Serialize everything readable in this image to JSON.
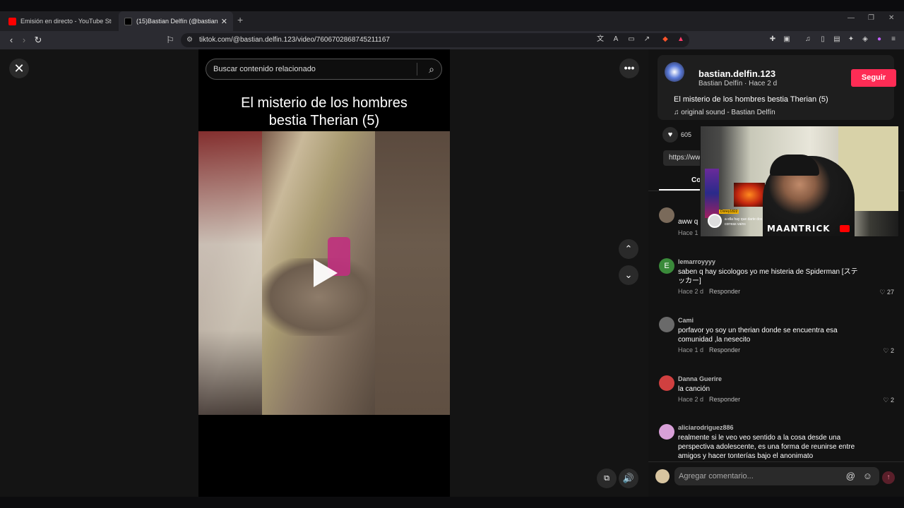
{
  "browser": {
    "tabs": [
      {
        "title": "Emisión en directo - YouTube Studio",
        "favicon_color": "#ff0000"
      },
      {
        "title": "(15)Bastian Delfín (@bastian.delfin",
        "favicon_color": "#000000"
      }
    ],
    "url": "tiktok.com/@bastian.delfin.123/video/7606702868745211167"
  },
  "video": {
    "search_placeholder": "Buscar contenido relacionado",
    "title_line1": "El misterio de los hombres",
    "title_line2": "bestia Therian (5)"
  },
  "author": {
    "username": "bastian.delfin.123",
    "display": "Bastian Delfín · Hace 2 d",
    "follow_label": "Seguir",
    "description": "El misterio de los hombres bestia Therian (5)",
    "sound": "original sound - Bastian Delfín"
  },
  "stats": {
    "likes": "605",
    "link_text": "https://ww",
    "comments_tab": "Co"
  },
  "comments": [
    {
      "name": "",
      "text": "aww q",
      "meta": "Hace 1",
      "reply": "",
      "likes": "",
      "avatar": "#7a6a5a"
    },
    {
      "name": "lemarroyyyy",
      "text": "saben q hay sicologos yo me histeria de Spiderman [ステッカー]",
      "meta": "Hace 2 d",
      "reply": "Responder",
      "likes": "27",
      "avatar": "#3a8a3a"
    },
    {
      "name": "Cami",
      "text": "porfavor yo soy un therian donde se encuentra esa comunidad ,la nesecito",
      "meta": "Hace 1 d",
      "reply": "Responder",
      "likes": "2",
      "avatar": "#6a6a6a"
    },
    {
      "name": "Danna Guerire",
      "text": "la canción",
      "meta": "Hace 2 d",
      "reply": "Responder",
      "likes": "2",
      "avatar": "#d04040"
    },
    {
      "name": "aliciarodriguez886",
      "text": "realmente si le veo veo sentido a la cosa desde una perspectiva adolescente, es una forma de reunirse entre amigos y hacer tonterías bajo el anonimato",
      "meta": "",
      "reply": "",
      "likes": "",
      "avatar": "#d8a0d8"
    }
  ],
  "comment_input": {
    "placeholder": "Agregar comentario..."
  },
  "webcam": {
    "brand": "MAANTRICK",
    "chat_name": "Dorey1822",
    "chat_msg": "a ella hay que darte dos correas vains"
  }
}
